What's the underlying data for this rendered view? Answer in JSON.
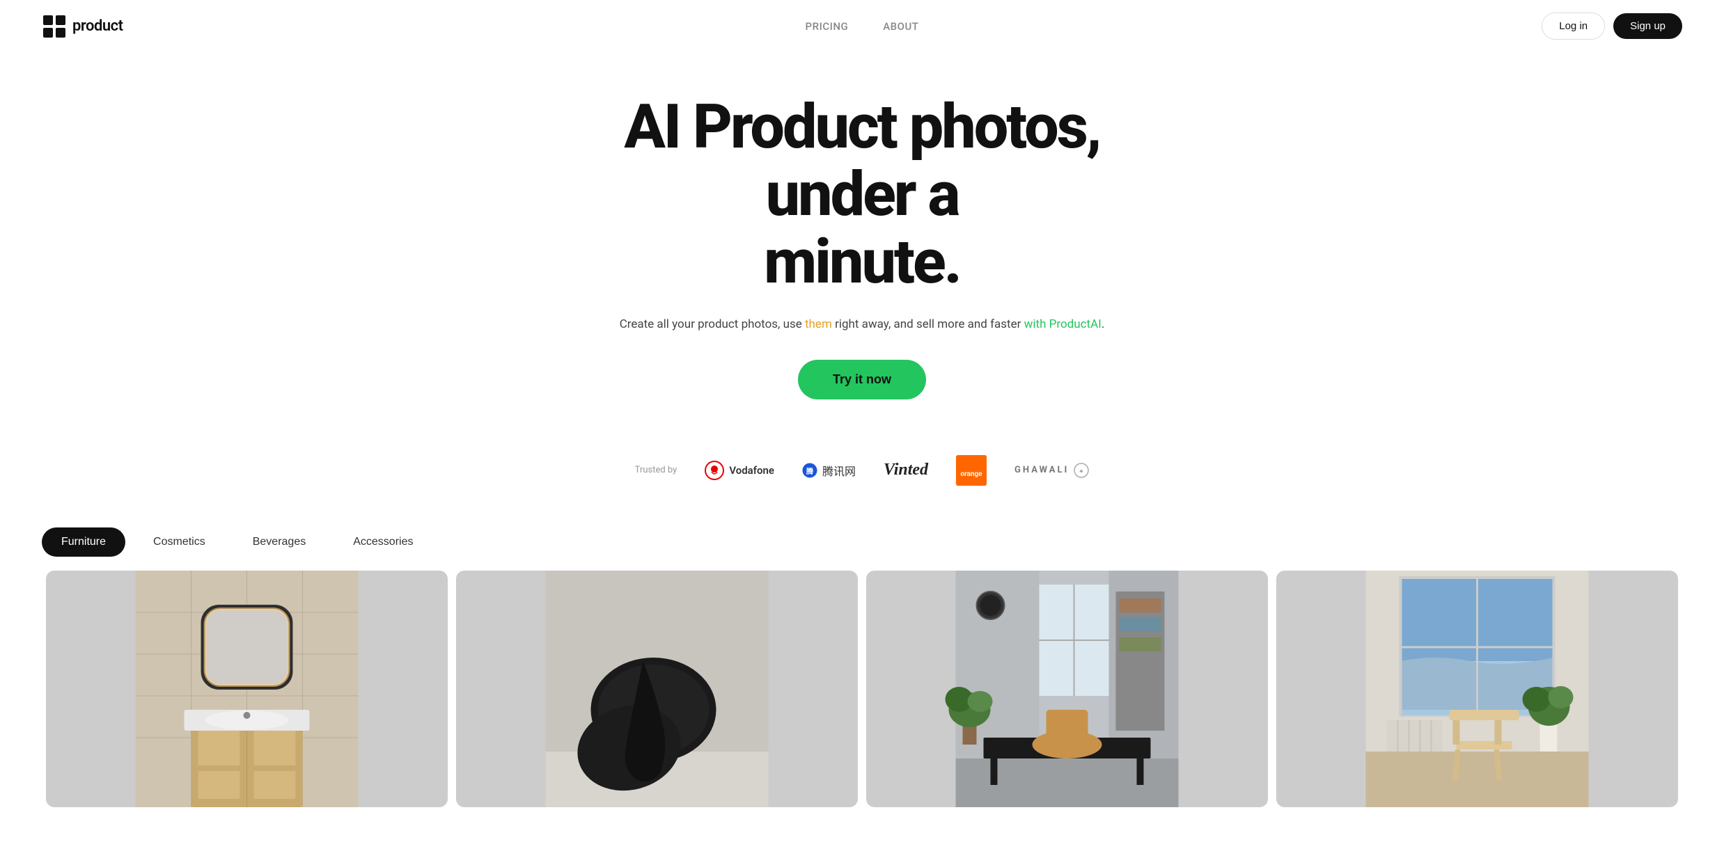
{
  "navbar": {
    "logo_text": "product",
    "links": [
      {
        "label": "PRICING",
        "href": "#pricing"
      },
      {
        "label": "ABOUT",
        "href": "#about"
      }
    ],
    "login_label": "Log in",
    "signup_label": "Sign up"
  },
  "hero": {
    "title_line1": "AI Product photos, under a",
    "title_line2": "minute.",
    "subtitle_before": "Create all your product photos, use ",
    "subtitle_highlight1": "them",
    "subtitle_middle": " right away, and sell more and faster ",
    "subtitle_highlight2": "with ProductAI",
    "subtitle_after": ".",
    "cta_label": "Try it now"
  },
  "trusted": {
    "label": "Trusted by",
    "brands": [
      {
        "name": "Vodafone",
        "type": "vodafone"
      },
      {
        "name": "腾讯网",
        "type": "tencent"
      },
      {
        "name": "Vinted",
        "type": "vinted"
      },
      {
        "name": "orange",
        "type": "orange"
      },
      {
        "name": "GHAWALI",
        "type": "ghawali"
      }
    ]
  },
  "categories": {
    "tabs": [
      {
        "label": "Furniture",
        "active": true
      },
      {
        "label": "Cosmetics",
        "active": false
      },
      {
        "label": "Beverages",
        "active": false
      },
      {
        "label": "Accessories",
        "active": false
      }
    ]
  },
  "gallery": {
    "images": [
      {
        "alt": "Bathroom vanity with mirror",
        "type": "bathroom"
      },
      {
        "alt": "Black decorative pillows on white surface",
        "type": "pillows"
      },
      {
        "alt": "Modern office workspace with desk and chairs",
        "type": "office"
      },
      {
        "alt": "Light wood step stool near window with ocean view",
        "type": "stool"
      }
    ]
  },
  "colors": {
    "accent_green": "#22c55e",
    "highlight_them": "#e8a020",
    "highlight_product": "#22c55e",
    "dark": "#111111",
    "orange_brand": "#ff6600"
  }
}
